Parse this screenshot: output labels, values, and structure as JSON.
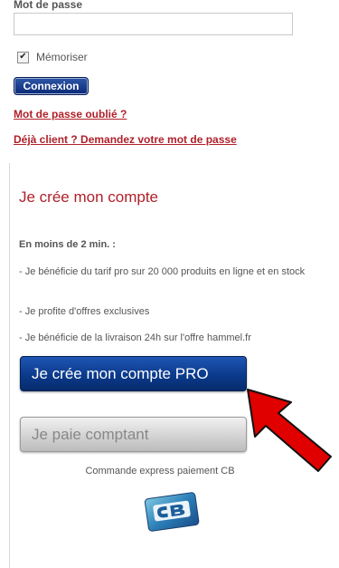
{
  "login": {
    "password_label": "Mot de passe",
    "password_value": "",
    "remember_label": "Mémoriser",
    "remember_checked": true,
    "connect_button": "Connexion",
    "forgot_link": "Mot de passe oublié ?",
    "already_client_link": "Déjà client ? Demandez votre mot de passe"
  },
  "signup": {
    "title": "Je crée mon compte",
    "intro": "En moins de 2 min. :",
    "bullets": [
      "- Je bénéficie du tarif pro sur 20 000 produits en ligne et en stock",
      "- Je profite d'offres exclusives",
      "- Je bénéficie de la livraison 24h sur l'offre hammel.fr"
    ],
    "create_pro_button": "Je crée mon compte PRO",
    "pay_cash_button": "Je paie comptant",
    "express_text": "Commande express paiement CB"
  },
  "colors": {
    "accent_red": "#b0202a",
    "button_blue": "#0b3a8c",
    "arrow_red": "#e00000"
  },
  "icons": {
    "checkbox": "check-icon",
    "card_logo": "cb-card-logo",
    "pointer": "red-arrow-icon"
  }
}
